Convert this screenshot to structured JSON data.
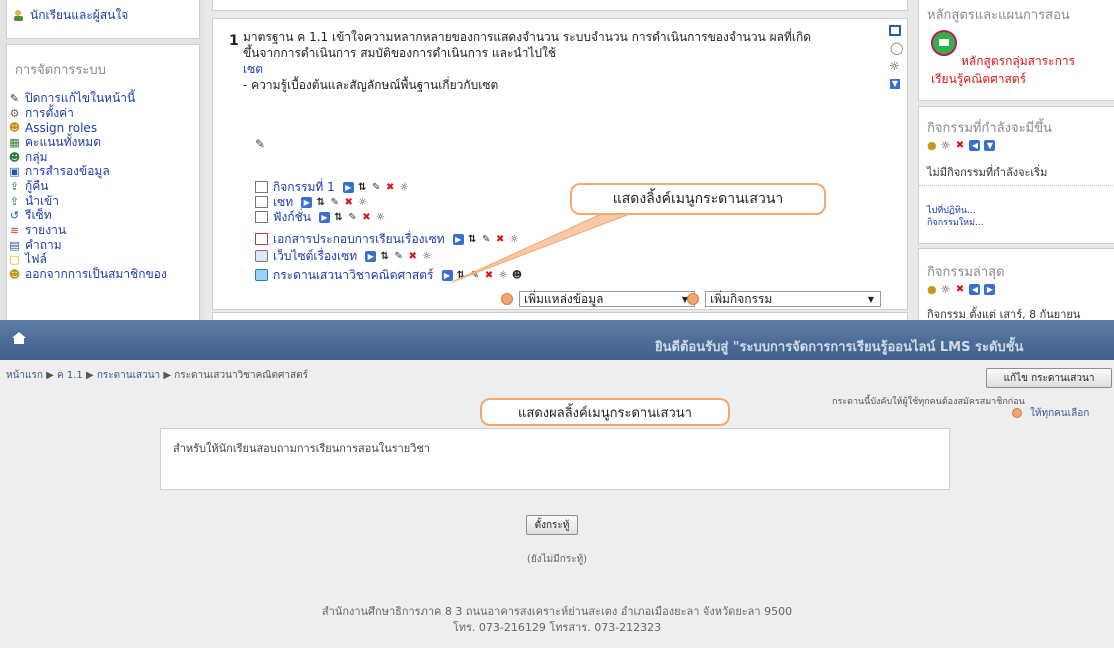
{
  "top": {
    "left_column": {
      "prev_item": "นักเรียนและผู้สนใจ",
      "admin_title": "การจัดการระบบ",
      "admin_items": [
        {
          "label": "ปิดการแก้ไขในหน้านี้",
          "icon": "pencil-icon"
        },
        {
          "label": "การตั้งค่า",
          "icon": "wrench-icon"
        },
        {
          "label": "Assign roles",
          "icon": "user-icon"
        },
        {
          "label": "คะแนนทั้งหมด",
          "icon": "grades-icon"
        },
        {
          "label": "กลุ่ม",
          "icon": "group-icon"
        },
        {
          "label": "การสำรองข้อมูล",
          "icon": "save-icon"
        },
        {
          "label": "กู้คืน",
          "icon": "restore-icon"
        },
        {
          "label": "นำเข้า",
          "icon": "import-icon"
        },
        {
          "label": "รีเซ็ท",
          "icon": "reset-icon"
        },
        {
          "label": "รายงาน",
          "icon": "report-icon"
        },
        {
          "label": "คำถาม",
          "icon": "question-icon"
        },
        {
          "label": "ไฟล์",
          "icon": "folder-icon"
        },
        {
          "label": "ออกจากการเป็นสมาชิกของ",
          "icon": "unenrol-icon"
        }
      ]
    },
    "section": {
      "number": "1",
      "summary_line1": "มาตรฐาน ค 1.1 เข้าใจความหลากหลายของการแสดงจำนวน ระบบจำนวน การดำเนินการของจำนวน ผลที่เกิด",
      "summary_line2": "ขึ้นจากการดำเนินการ สมบัติของการดำเนินการ และนำไปใช้",
      "link": "เซต",
      "bullet": "- ความรู้เบื้องต้นและสัญลักษณ์พื้นฐานเกี่ยวกับเซต",
      "activities": [
        {
          "label": "กิจกรรมที่ 1",
          "icon": "page-icon"
        },
        {
          "label": "เซท",
          "icon": "page-icon"
        },
        {
          "label": "ฟังก์ชั่น",
          "icon": "page-icon"
        },
        {
          "label": "เอกสารประกอบการเรียนเรื่องเซท",
          "icon": "pdf-icon"
        },
        {
          "label": "เว็บไซต์เรื่องเซท",
          "icon": "web-icon"
        },
        {
          "label": "กระดานเสวนาวิชาคณิตศาสตร์",
          "icon": "forum-icon"
        }
      ],
      "add_resource": "เพิ่มแหล่งข้อมูล",
      "add_activity": "เพิ่มกิจกรรม"
    },
    "callout": "แสดงลิ้งค์เมนูกระดานเสวนา",
    "right_column": {
      "curriculum_title": "หลักสูตรและแผนการสอน",
      "curriculum_link1": "หลักสูตรกลุ่มสาระการ",
      "curriculum_link2": "เรียนรู้คณิตศาสตร์",
      "upcoming_title": "กิจกรรมที่กำลังจะมีขึ้น",
      "upcoming_none": "ไม่มีกิจกรรมที่กำลังจะเริ่ม",
      "goto_calendar": "ไปที่ปฏิทิน...",
      "new_event": "กิจกรรมใหม่...",
      "recent_title": "กิจกรรมล่าสุด",
      "recent_text": "กิจกรรม ตั้งแต่ เสาร์, 8 กันยายน"
    }
  },
  "bottom": {
    "header_title": "ยินดีต้อนรับสู่ \"ระบบการจัดการการเรียนรู้ออนไลน์ LMS ระดับชั้น",
    "breadcrumb": [
      "หน้าแรก",
      "ค 1.1",
      "กระดานเสวนา",
      "กระดานเสวนาวิชาคณิตศาสตร์"
    ],
    "edit_button": "แก้ไข กระดานเสวนา",
    "forced_sub_note": "กระดานนี้บังคับให้ผู้ใช้ทุกคนต้องสมัครสมาชิกก่อน",
    "everyone_choice": "ให้ทุกคนเลือก",
    "callout": "แสดงผลลิ้งค์เมนูกระดานเสวนา",
    "intro": "สำหรับให้นักเรียนสอบถามการเรียนการสอนในรายวิชา",
    "new_topic_button": "ตั้งกระทู้",
    "no_topics": "(ยังไม่มีกระทู้)",
    "footer_line1": "สำนักงานศึกษาธิการภาค 8 3 ถนนอาคารสงเคราะห์ย่านสะเตง อำเภอเมืองยะลา จังหวัดยะลา 9500",
    "footer_line2": "โทร. 073-216129 โทรสาร. 073-212323"
  },
  "colors": {
    "link": "#1a3cb0",
    "red_link": "#d8151b",
    "navbar": "#4a6a96",
    "callout_border": "#f2a870"
  }
}
